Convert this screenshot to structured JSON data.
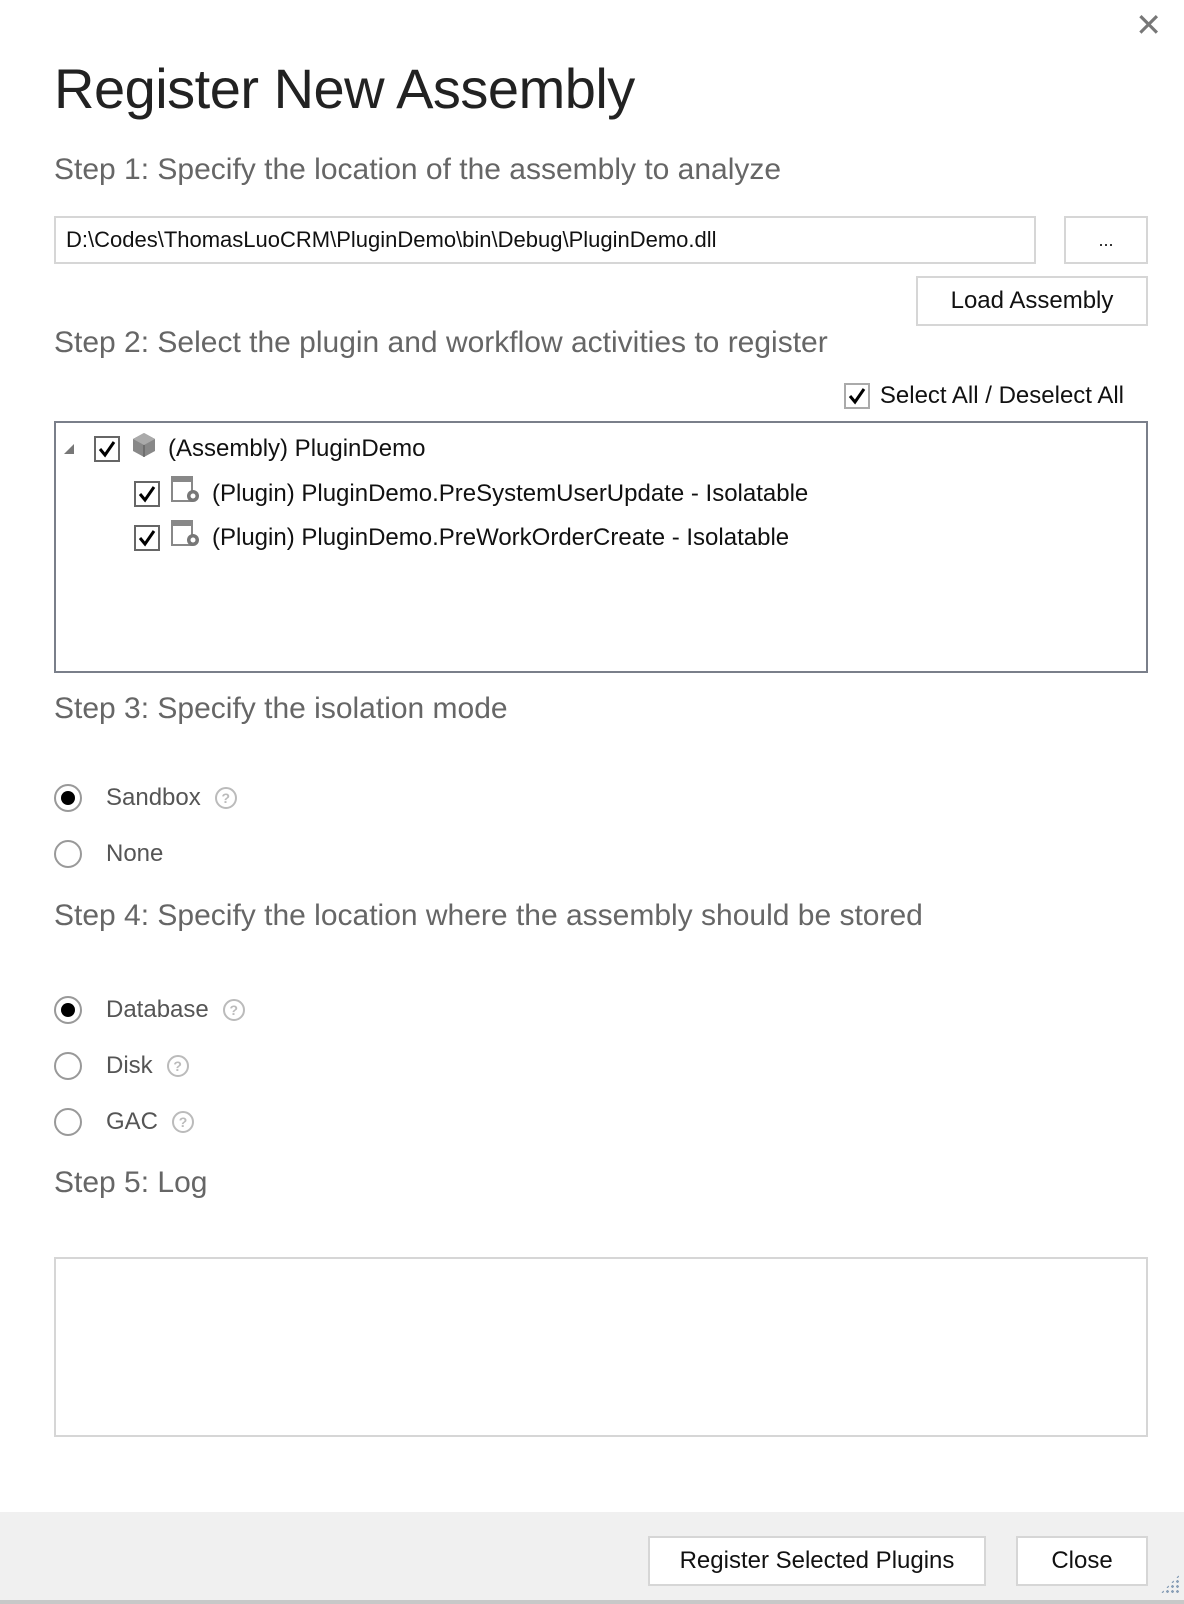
{
  "dialog": {
    "title": "Register New Assembly",
    "close_icon": "close-icon"
  },
  "step1": {
    "heading": "Step 1: Specify the location of the assembly to analyze",
    "path_value": "D:\\Codes\\ThomasLuoCRM\\PluginDemo\\bin\\Debug\\PluginDemo.dll",
    "browse_label": "...",
    "load_label": "Load Assembly"
  },
  "step2": {
    "heading": "Step 2: Select the plugin and workflow activities to register",
    "select_all_label": "Select All / Deselect All",
    "select_all_checked": true,
    "tree": {
      "assembly": {
        "label": "(Assembly) PluginDemo",
        "checked": true,
        "expanded": true,
        "icon": "assembly-icon"
      },
      "plugins": [
        {
          "label": "(Plugin) PluginDemo.PreSystemUserUpdate - Isolatable",
          "checked": true,
          "icon": "plugin-icon"
        },
        {
          "label": "(Plugin) PluginDemo.PreWorkOrderCreate - Isolatable",
          "checked": true,
          "icon": "plugin-icon"
        }
      ]
    }
  },
  "step3": {
    "heading": "Step 3: Specify the isolation mode",
    "options": [
      {
        "label": "Sandbox",
        "selected": true,
        "help": true
      },
      {
        "label": "None",
        "selected": false,
        "help": false
      }
    ]
  },
  "step4": {
    "heading": "Step 4: Specify the location where the assembly should be stored",
    "options": [
      {
        "label": "Database",
        "selected": true,
        "help": true
      },
      {
        "label": "Disk",
        "selected": false,
        "help": true
      },
      {
        "label": "GAC",
        "selected": false,
        "help": true
      }
    ]
  },
  "step5": {
    "heading": "Step 5: Log",
    "log_text": ""
  },
  "footer": {
    "register_label": "Register Selected Plugins",
    "close_label": "Close"
  },
  "help_glyph": "?"
}
